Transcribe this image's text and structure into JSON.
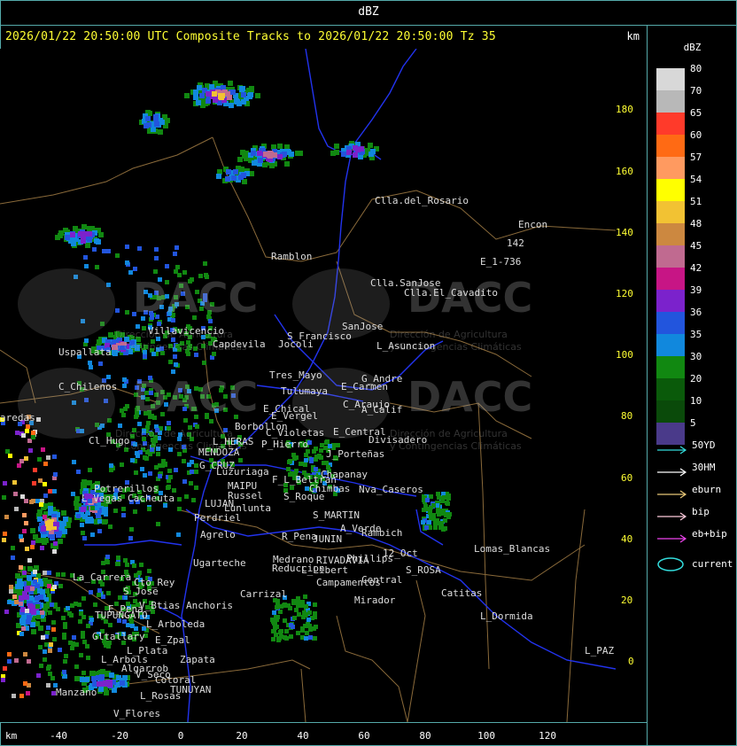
{
  "title": "dBZ",
  "header": {
    "tracks": "2026/01/22 20:50:00 UTC Composite Tracks to 2026/01/22 20:50:00 Tz 35",
    "km": "km"
  },
  "legend": {
    "unit": "dBZ",
    "scale": [
      {
        "value": "80",
        "color": "#d8d8d8"
      },
      {
        "value": "70",
        "color": "#b8b8b8"
      },
      {
        "value": "65",
        "color": "#ff3a2a"
      },
      {
        "value": "60",
        "color": "#ff6a14"
      },
      {
        "value": "57",
        "color": "#ff9a60"
      },
      {
        "value": "54",
        "color": "#ffff00"
      },
      {
        "value": "51",
        "color": "#f2c233"
      },
      {
        "value": "48",
        "color": "#cc8840"
      },
      {
        "value": "45",
        "color": "#c06a90"
      },
      {
        "value": "42",
        "color": "#c71585"
      },
      {
        "value": "39",
        "color": "#7b22cc"
      },
      {
        "value": "36",
        "color": "#2255dd"
      },
      {
        "value": "35",
        "color": "#1188dd"
      },
      {
        "value": "30",
        "color": "#118811"
      },
      {
        "value": "20",
        "color": "#0a5a0a"
      },
      {
        "value": "10",
        "color": "#0a4a0a"
      },
      {
        "value": "5",
        "color": "#4a3a8a"
      }
    ],
    "tracks": [
      {
        "label": "50YD",
        "color": "#33dddd"
      },
      {
        "label": "30HM",
        "color": "#ffffff"
      },
      {
        "label": "eburn",
        "color": "#e8c878"
      },
      {
        "label": "bip",
        "color": "#ffccdd"
      },
      {
        "label": "eb+bip",
        "color": "#ee44ee"
      }
    ],
    "current": {
      "label": "current",
      "color": "#33dddd"
    }
  },
  "y_axis": {
    "ticks": [
      "180",
      "160",
      "140",
      "120",
      "100",
      "80",
      "60",
      "40",
      "20",
      "0"
    ],
    "color": "#ffff33"
  },
  "x_axis": {
    "unit": "km",
    "ticks": [
      "-40",
      "-20",
      "0",
      "20",
      "40",
      "60",
      "80",
      "100",
      "120"
    ]
  },
  "watermarks": [
    {
      "name": "DACC",
      "sub1": "Dirección de Agricultura",
      "sub2": "y Contingencias Climáticas"
    },
    {
      "name": "DACC",
      "sub1": "Dirección de Agricultura",
      "sub2": "y Contingencias Climáticas"
    },
    {
      "name": "DACC",
      "sub1": "Dirección de Agricultura",
      "sub2": "y Contingencias Climáticas"
    },
    {
      "name": "DACC",
      "sub1": "Dirección de Agricultura",
      "sub2": "y Contingencias Climáticas"
    }
  ],
  "places": [
    "Clla.del_Rosario",
    "Encon",
    "142",
    "E_1-736",
    "Ramblon",
    "Clla.SanJose",
    "Clla.El_Cavadito",
    "Villavicencio",
    "Capdevila",
    "S_Francisco",
    "SanJose",
    "L_Asuncion",
    "Uspallata",
    "Jocoli",
    "Tres_Mayo",
    "G_Andre",
    "C_Chilenos",
    "Tulumaya",
    "E_Carmen",
    "E_Chical",
    "C_Araujo",
    "A_Calif",
    "E_Vergel",
    "Borbollon",
    "C_Violetas",
    "E_Central",
    "Divisadero",
    "L_HERAS",
    "P_Hierro",
    "Cl_Hugo",
    "MENDOZA",
    "J_Porteñas",
    "Chapanay",
    "G_CRUZ",
    "Luzuriaga",
    "F_L_Beltran",
    "Chimbas",
    "Nva_Caseros",
    "Potrerillos",
    "MAIPU",
    "Russel",
    "S_Roque",
    "L_Vegas",
    "Cacheuta",
    "LUJAN",
    "Lunlunta",
    "Perdriel",
    "S_MARTIN",
    "A_Verde",
    "Rambich",
    "Agrelo",
    "R_Pena",
    "JUNIN",
    "Lomas_Blancas",
    "Ugarteche",
    "Medrano",
    "RIVADAVIA",
    "Phillips",
    "12_Oct",
    "Reduccion",
    "L_Libert",
    "S_ROSA",
    "La_Carrera",
    "Cto_Rey",
    "S_Jose",
    "Carrizal",
    "Campamentos",
    "Central",
    "Catitas",
    "E_Pena",
    "V_Btias",
    "Anchoris",
    "Mirador",
    "TUPUNGATO",
    "L_Arboleda",
    "L_Dormida",
    "E_Zpal",
    "Gltallary",
    "L_Plata",
    "L_Arbols",
    "Zapata",
    "L_PAZ",
    "Algarrob",
    "V_Seco",
    "Cotoral",
    "TUNUYAN",
    "Manzano",
    "L_Rosas",
    "V_Flores",
    "aredas"
  ]
}
